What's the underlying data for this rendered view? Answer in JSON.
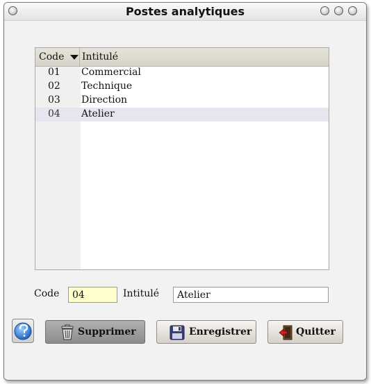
{
  "window": {
    "title": "Postes analytiques"
  },
  "grid": {
    "columns": [
      "Code",
      "Intitulé"
    ],
    "rows": [
      {
        "code": "01",
        "label": "Commercial"
      },
      {
        "code": "02",
        "label": "Technique"
      },
      {
        "code": "03",
        "label": "Direction"
      },
      {
        "code": "04",
        "label": "Atelier"
      }
    ],
    "selected": "04"
  },
  "form": {
    "code_label": "Code",
    "code_value": "04",
    "intitule_label": "Intitulé",
    "intitule_value": "Atelier"
  },
  "buttons": {
    "delete_label": "Supprimer",
    "save_label": "Enregistrer",
    "quit_label": "Quitter"
  },
  "icons": {
    "help": "help-icon",
    "delete": "trash-icon",
    "save": "floppy-disk-icon",
    "quit": "exit-door-icon"
  },
  "colors": {
    "code_field_bg": "#ffffcc",
    "selected_row_bg": "#e6e6f0",
    "header_bg": "#dcd8cd"
  }
}
